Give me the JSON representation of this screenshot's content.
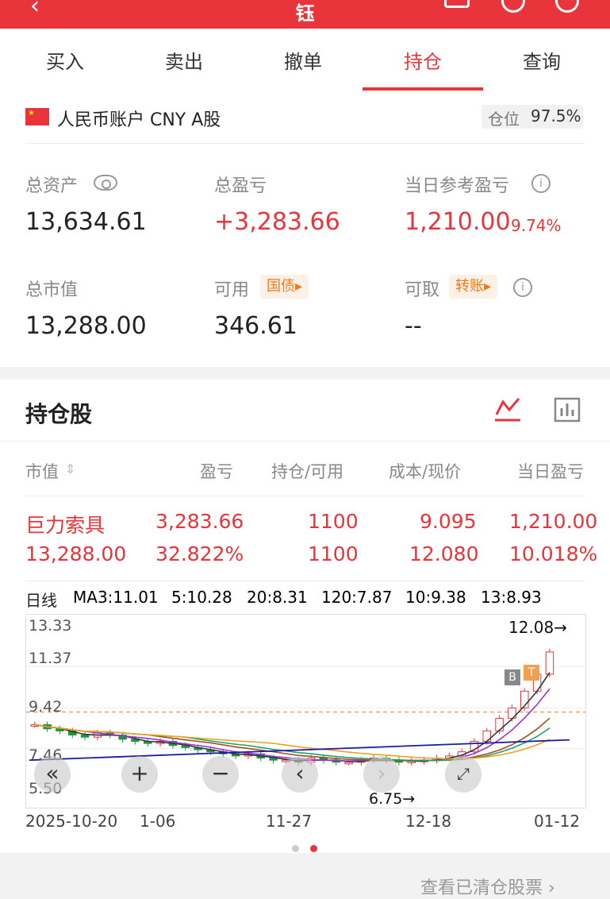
{
  "header": {
    "title": "钰",
    "back": "‹"
  },
  "tabs": [
    {
      "label": "买入"
    },
    {
      "label": "卖出"
    },
    {
      "label": "撤单"
    },
    {
      "label": "持仓"
    },
    {
      "label": "查询"
    }
  ],
  "account": {
    "name": "人民币账户 CNY A股",
    "position_label": "仓位",
    "position_value": "97.5%"
  },
  "summary": {
    "total_assets_label": "总资产",
    "total_assets": "13,634.61",
    "total_pl_label": "总盈亏",
    "total_pl": "+3,283.66",
    "day_pl_label": "当日参考盈亏",
    "day_pl": "1,210.00",
    "day_pl_pct": "9.74%",
    "market_value_label": "总市值",
    "market_value": "13,288.00",
    "available_label": "可用",
    "available": "346.61",
    "bond_chip": "国债▸",
    "withdrawable_label": "可取",
    "withdrawable": "--",
    "transfer_chip": "转账▸"
  },
  "holdings": {
    "title": "持仓股",
    "columns": {
      "market_value": "市值",
      "pl": "盈亏",
      "position": "持仓/可用",
      "cost": "成本/现价",
      "day_pl": "当日盈亏"
    },
    "rows": [
      {
        "name": "巨力索具",
        "pl": "3,283.66",
        "position": "1100",
        "cost": "9.095",
        "day_pl": "1,210.00",
        "market_value": "13,288.00",
        "pl_pct": "32.822%",
        "available": "1100",
        "price": "12.080",
        "day_pl_pct": "10.018%"
      }
    ]
  },
  "chart": {
    "period": "日线",
    "ma": [
      {
        "label": "MA3:11.01",
        "color": "#333333"
      },
      {
        "label": "5:10.28",
        "color": "#9b30e0"
      },
      {
        "label": "20:8.31",
        "color": "#f0a020"
      },
      {
        "label": "120:7.87",
        "color": "#1a1aa0"
      },
      {
        "label": "10:9.38",
        "color": "#a05018"
      },
      {
        "label": "13:8.93",
        "color": "#20a070"
      }
    ],
    "y_ticks": [
      "13.33",
      "11.37",
      "9.42",
      "7.46",
      "5.50"
    ],
    "x_ticks": [
      "2025-10-20",
      "1-06",
      "11-27",
      "12-18",
      "01-12"
    ],
    "high_label": "12.08→",
    "low_label": "6.75→",
    "markers": [
      "B",
      "T"
    ]
  },
  "chart_data": {
    "type": "candlestick",
    "ylim": [
      5.5,
      13.33
    ],
    "x_labels": [
      "2025-10-20",
      "1-06",
      "11-27",
      "12-18",
      "01-12"
    ],
    "close": [
      8.6,
      8.4,
      8.3,
      8.1,
      8.0,
      8.2,
      8.1,
      7.9,
      7.8,
      7.7,
      7.8,
      7.6,
      7.5,
      7.4,
      7.3,
      7.2,
      7.1,
      7.2,
      7.0,
      6.9,
      6.9,
      6.8,
      7.0,
      6.9,
      6.8,
      6.8,
      6.9,
      7.0,
      6.9,
      6.8,
      6.85,
      6.9,
      7.0,
      7.1,
      7.3,
      7.8,
      8.3,
      8.9,
      9.4,
      10.2,
      11.01,
      12.08
    ],
    "max": 12.08,
    "min": 6.75,
    "reference_line": 9.2
  },
  "pager": {
    "dots": 2,
    "active": 1
  },
  "footer": {
    "link": "查看已清仓股票 ›"
  },
  "colors": {
    "brand": "#e8343a",
    "orange": "#f07a1a"
  }
}
